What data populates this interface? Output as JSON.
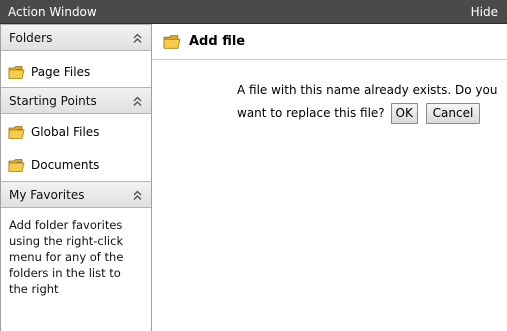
{
  "window": {
    "title": "Action Window",
    "hide_label": "Hide"
  },
  "sidebar": {
    "folders": {
      "header": "Folders",
      "items": [
        {
          "label": "Page Files"
        }
      ]
    },
    "starting_points": {
      "header": "Starting Points",
      "items": [
        {
          "label": "Global Files"
        },
        {
          "label": "Documents"
        }
      ]
    },
    "favorites": {
      "header": "My Favorites",
      "help_text": "Add folder favorites using the right-click menu for any of the folders in the list to the right"
    }
  },
  "main": {
    "title": "Add file",
    "message_line1": "A file with this name already exists. Do you",
    "message_line2": "want to replace this file?",
    "ok_label": "OK",
    "cancel_label": "Cancel"
  },
  "icons": {
    "folder": "folder-icon",
    "collapse": "double-chevron-up-icon"
  },
  "colors": {
    "titlebar": "#4a4a4a",
    "folder_yellow": "#f2c23a",
    "folder_blue": "#3b6fd0"
  }
}
